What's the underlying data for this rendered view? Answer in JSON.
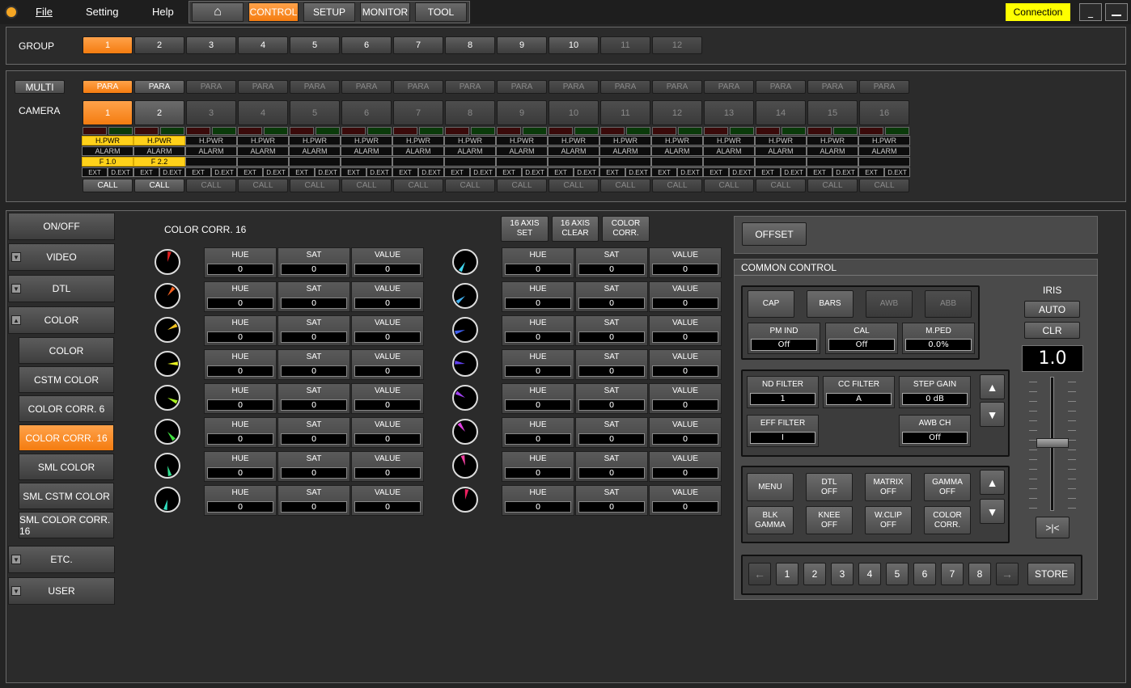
{
  "menu": {
    "file": "File",
    "setting": "Setting",
    "help": "Help"
  },
  "tabs": [
    "CONTROL",
    "SETUP",
    "MONITOR",
    "TOOL"
  ],
  "connection": "Connection",
  "group": {
    "label": "GROUP",
    "items": [
      "1",
      "2",
      "3",
      "4",
      "5",
      "6",
      "7",
      "8",
      "9",
      "10",
      "11",
      "12"
    ]
  },
  "camera": {
    "multi": "MULTI",
    "label": "CAMERA",
    "para": "PARA",
    "items": [
      "1",
      "2",
      "3",
      "4",
      "5",
      "6",
      "7",
      "8",
      "9",
      "10",
      "11",
      "12",
      "13",
      "14",
      "15",
      "16"
    ],
    "hpwr": "H.PWR",
    "alarm": "ALARM",
    "iris": [
      "F 1.0",
      "F 2.2"
    ],
    "ext": "EXT",
    "dext": "D.EXT",
    "call": "CALL"
  },
  "sidebar": {
    "onoff": "ON/OFF",
    "video": "VIDEO",
    "dtl": "DTL",
    "color": "COLOR",
    "sub": [
      "COLOR",
      "CSTM COLOR",
      "COLOR CORR. 6",
      "COLOR CORR. 16",
      "SML COLOR",
      "SML CSTM COLOR",
      "SML COLOR CORR. 16"
    ],
    "etc": "ETC.",
    "user": "USER"
  },
  "cc": {
    "title": "COLOR CORR. 16",
    "axis_set": "16 AXIS SET",
    "axis_clear": "16 AXIS CLEAR",
    "color_corr": "COLOR CORR.",
    "hue": "HUE",
    "sat": "SAT",
    "value": "VALUE",
    "zero": "0",
    "left_colors": [
      "#e02020",
      "#f06020",
      "#f0c020",
      "#e8f020",
      "#a8f020",
      "#40e040",
      "#30e090",
      "#30e0c0"
    ],
    "right_colors": [
      "#40d8f0",
      "#40b0f0",
      "#4060f0",
      "#6040f0",
      "#a040f0",
      "#e040e0",
      "#f040a0",
      "#f02060"
    ]
  },
  "right": {
    "offset": "OFFSET",
    "common": "COMMON CONTROL",
    "cap": "CAP",
    "bars": "BARS",
    "awb": "AWB",
    "abb": "ABB",
    "pm_ind": "PM IND",
    "pm_ind_v": "Off",
    "cal": "CAL",
    "cal_v": "Off",
    "mped": "M.PED",
    "mped_v": "0.0%",
    "nd": "ND FILTER",
    "nd_v": "1",
    "cc": "CC FILTER",
    "cc_v": "A",
    "step": "STEP GAIN",
    "step_v": "0 dB",
    "eff": "EFF FILTER",
    "eff_v": "I",
    "awbch": "AWB CH",
    "awbch_v": "Off",
    "menu": "MENU",
    "dtl": "DTL",
    "dtl_v": "OFF",
    "matrix": "MATRIX",
    "matrix_v": "OFF",
    "gamma": "GAMMA",
    "gamma_v": "OFF",
    "blk": "BLK GAMMA",
    "knee": "KNEE",
    "knee_v": "OFF",
    "wclip": "W.CLIP",
    "wclip_v": "OFF",
    "colcorr": "COLOR",
    "colcorr2": "CORR.",
    "pages": [
      "1",
      "2",
      "3",
      "4",
      "5",
      "6",
      "7",
      "8"
    ],
    "store": "STORE",
    "iris": "IRIS",
    "auto": "AUTO",
    "clr": "CLR",
    "iris_value": "1.0",
    "jump": ">|<"
  }
}
